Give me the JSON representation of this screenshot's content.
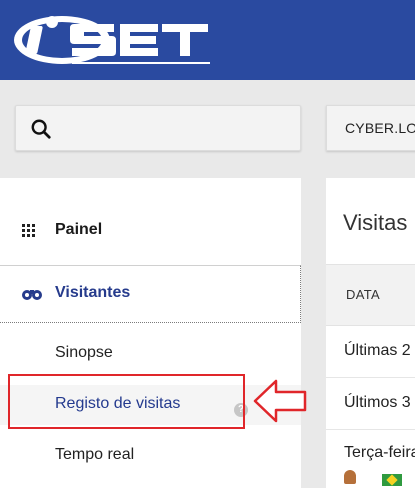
{
  "header": {
    "logo_text": "iSET",
    "brand_color": "#2a4aa0"
  },
  "search": {
    "icon": "search-icon",
    "value": ""
  },
  "store": {
    "label": "CYBER.LOJA"
  },
  "sidebar": {
    "items": [
      {
        "label": "Painel",
        "icon": "grid-icon"
      },
      {
        "label": "Visitantes",
        "icon": "binoculars-icon"
      }
    ],
    "sub_items": [
      {
        "label": "Sinopse"
      },
      {
        "label": "Registo de visitas",
        "help": "?"
      },
      {
        "label": "Tempo real"
      }
    ]
  },
  "main": {
    "title": "Visitas",
    "table": {
      "header": "DATA",
      "rows": [
        "Últimas 2",
        "Últimos 3",
        "Terça-feira"
      ]
    }
  },
  "annotation": {
    "color": "#e0262a"
  }
}
